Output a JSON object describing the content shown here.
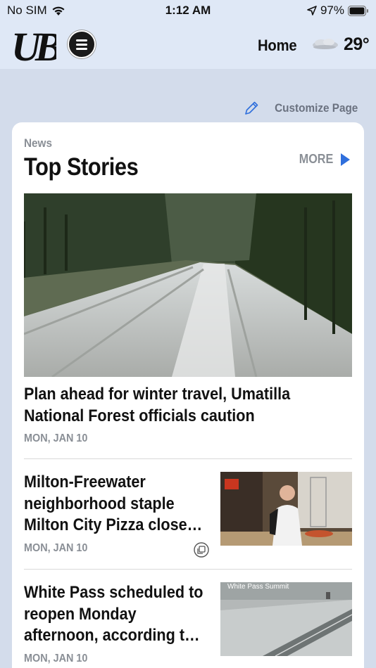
{
  "status": {
    "carrier": "No SIM",
    "time": "1:12 AM",
    "battery": "97%"
  },
  "header": {
    "logo_text": "UB",
    "home_label": "Home",
    "temperature": "29°",
    "weather_icon": "cloud-icon"
  },
  "customize": {
    "label": "Customize Page"
  },
  "section": {
    "label": "News",
    "title": "Top Stories",
    "more_label": "MORE",
    "accent": "#2f6fdc"
  },
  "stories": [
    {
      "title": "Plan ahead for winter travel, Umatilla National Forest officials caution",
      "date": "MON, JAN 10"
    },
    {
      "title": "Milton-Freewater neighborhood staple Milton City Pizza close…",
      "date": "MON, JAN 10"
    },
    {
      "title": "White Pass scheduled to reopen Monday afternoon, according t…",
      "date": "MON, JAN 10",
      "thumb_caption": "White Pass Summit"
    }
  ]
}
